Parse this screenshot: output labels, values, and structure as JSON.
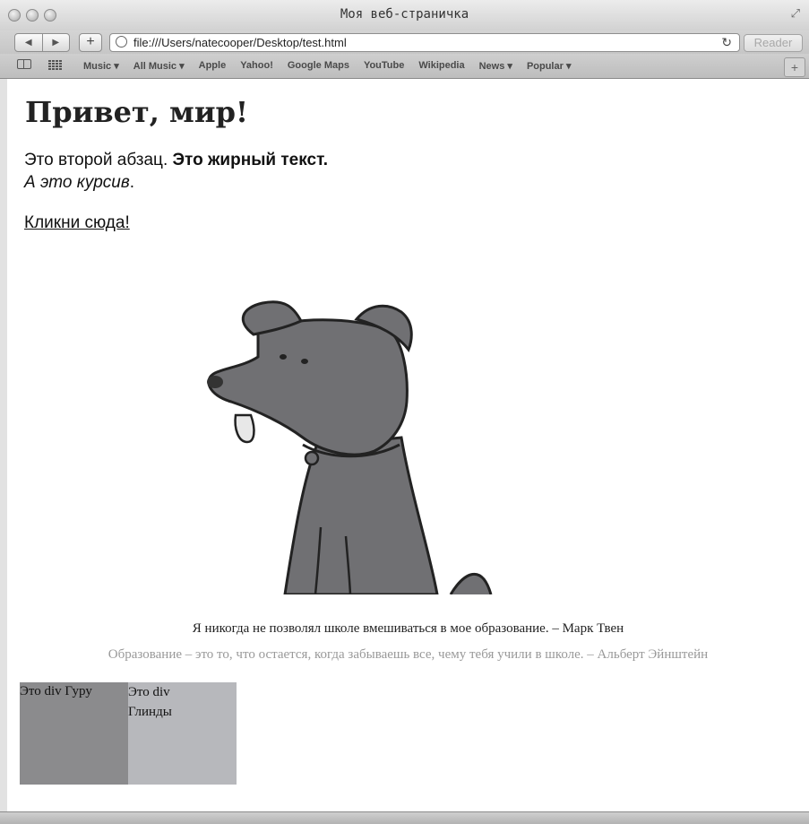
{
  "window": {
    "title": "Моя веб-страничка"
  },
  "toolbar": {
    "back_glyph": "◀",
    "forward_glyph": "▶",
    "add_glyph": "+",
    "url": "file:///Users/natecooper/Desktop/test.html",
    "reload_glyph": "↻",
    "reader_label": "Reader"
  },
  "bookmarks": {
    "items": [
      {
        "label": "Music ▾"
      },
      {
        "label": "All Music ▾"
      },
      {
        "label": "Apple"
      },
      {
        "label": "Yahoo!"
      },
      {
        "label": "Google Maps"
      },
      {
        "label": "YouTube"
      },
      {
        "label": "Wikipedia"
      },
      {
        "label": "News ▾"
      },
      {
        "label": "Popular ▾"
      }
    ],
    "plus_glyph": "+"
  },
  "page": {
    "heading": "Привет, мир!",
    "para_plain": "Это второй абзац. ",
    "para_bold": "Это жирный текст.",
    "para_italic": "А это курсив",
    "para_end": ".",
    "link": "Кликни сюда!",
    "quote1": "Я никогда не позволял школе вмешиваться в мое образование. – Марк Твен",
    "quote2": "Образование – это то, что остается, когда забываешь все, чему тебя учили в школе. – Альберт Эйнштейн",
    "div_guru": "Это div Гуру",
    "div_glinda": "Это div Глинды"
  },
  "colors": {
    "div_guru_bg": "#8b8b8d",
    "div_glinda_bg": "#b7b8bc",
    "quote2_text": "#999999"
  }
}
